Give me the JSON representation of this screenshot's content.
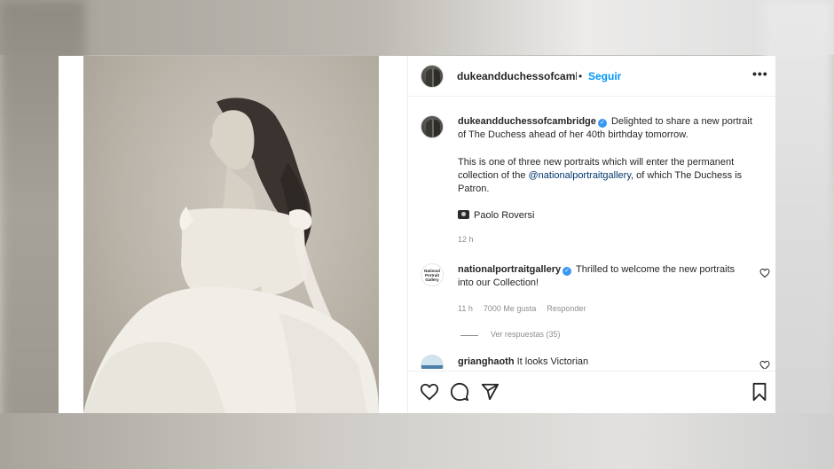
{
  "post": {
    "author": "dukeandduchessofcambridge",
    "header_author": "dukeandduchessofcambric",
    "follow_separator": "•",
    "follow_label": "Seguir",
    "more_label": "•••",
    "caption_line1": "Delighted to share a new portrait",
    "caption_line2": "of The Duchess ahead of her 40th birthday tomorrow.",
    "caption_para2_a": "This is one of three new portraits which will enter the permanent",
    "caption_para2_b": "collection of the",
    "caption_mention": "@nationalportraitgallery",
    "caption_para2_c": ", of which The Duchess is",
    "caption_para2_d": "Patron.",
    "photographer": "Paolo Roversi",
    "caption_time": "12 h"
  },
  "comments": [
    {
      "username": "nationalportraitgallery",
      "text_line1": "Thrilled to welcome the new portraits",
      "text_line2": "into our Collection!",
      "avatar_text": "National Portrait Gallery",
      "time": "11 h",
      "likes": "7000 Me gusta",
      "reply_label": "Responder",
      "view_replies": "Ver respuestas (35)"
    },
    {
      "username": "grianghaoth",
      "text": "It looks Victorian"
    }
  ],
  "icons": {
    "like": "heart-icon",
    "comment": "comment-icon",
    "share": "send-icon",
    "save": "bookmark-icon",
    "verified": "verified-badge-icon",
    "more": "more-options-icon"
  },
  "colors": {
    "accent": "#0095f6",
    "text": "#262626",
    "muted": "#8e8e8e",
    "verified": "#3897f0",
    "mention": "#00376b"
  }
}
